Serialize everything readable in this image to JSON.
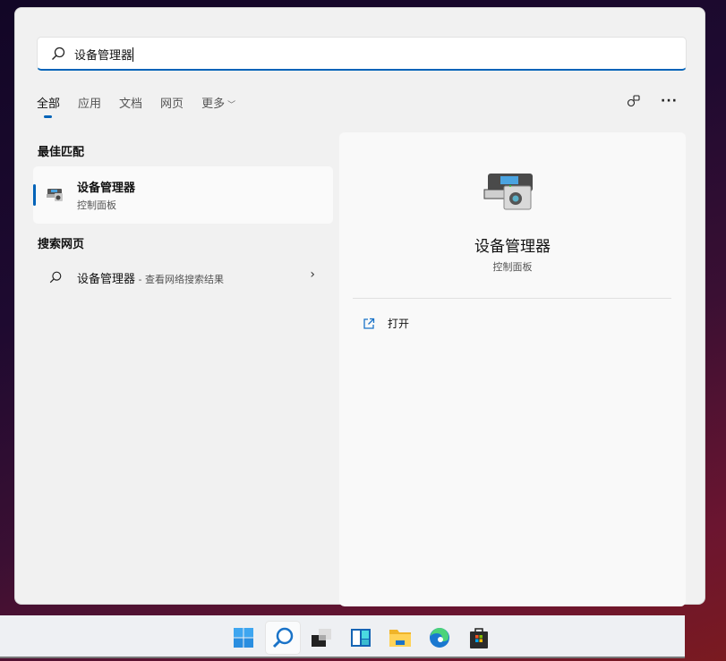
{
  "search": {
    "value": "设备管理器"
  },
  "tabs": [
    {
      "label": "全部"
    },
    {
      "label": "应用"
    },
    {
      "label": "文档"
    },
    {
      "label": "网页"
    },
    {
      "label": "更多"
    }
  ],
  "sections": {
    "best_match": "最佳匹配",
    "search_web": "搜索网页"
  },
  "best_match": {
    "title": "设备管理器",
    "subtitle": "控制面板"
  },
  "web_result": {
    "query": "设备管理器",
    "suffix": " - 查看网络搜索结果"
  },
  "detail": {
    "title": "设备管理器",
    "subtitle": "控制面板",
    "actions": [
      {
        "label": "打开"
      }
    ]
  },
  "taskbar": [
    "start",
    "search",
    "task-view",
    "widgets",
    "file-explorer",
    "edge",
    "store"
  ],
  "colors": {
    "accent": "#0063b8"
  }
}
